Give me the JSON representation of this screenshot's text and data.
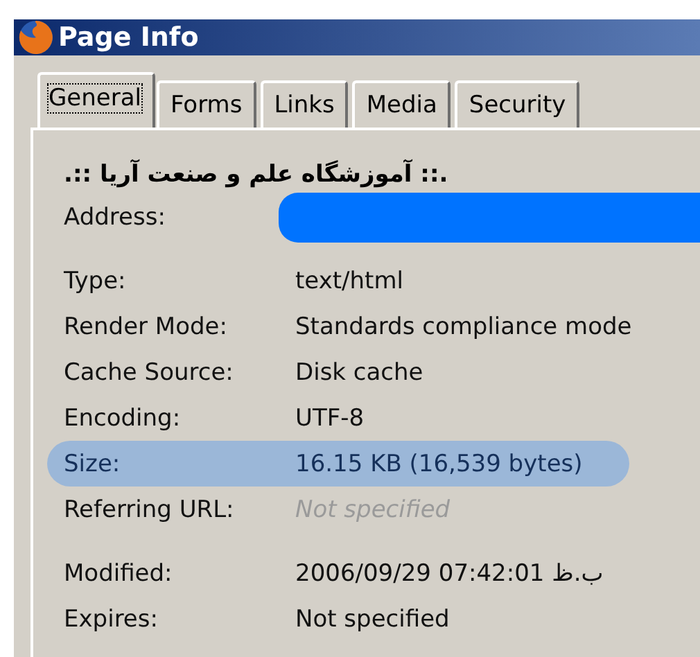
{
  "window": {
    "title": "Page Info"
  },
  "tabs": [
    {
      "label": "General",
      "selected": true
    },
    {
      "label": "Forms",
      "selected": false
    },
    {
      "label": "Links",
      "selected": false
    },
    {
      "label": "Media",
      "selected": false
    },
    {
      "label": "Security",
      "selected": false
    }
  ],
  "page_title": ".:: آموزشگاه علم و صنعت آریا ::.",
  "groups": [
    [
      {
        "label": "Address:",
        "redacted": true
      }
    ],
    [
      {
        "label": "Type:",
        "value": "text/html",
        "highlighted": false,
        "muted": false
      },
      {
        "label": "Render Mode:",
        "value": "Standards compliance mode",
        "highlighted": false,
        "muted": false
      },
      {
        "label": "Cache Source:",
        "value": "Disk cache",
        "highlighted": false,
        "muted": false
      },
      {
        "label": "Encoding:",
        "value": "UTF-8",
        "highlighted": false,
        "muted": false
      },
      {
        "label": "Size:",
        "value": "16.15 KB (16,539 bytes)",
        "highlighted": true,
        "muted": false
      },
      {
        "label": "Referring URL:",
        "value": "Not specified",
        "highlighted": false,
        "muted": true
      }
    ],
    [
      {
        "label": "Modified:",
        "value": "2006/09/29 07:42:01 ب.ظ",
        "highlighted": false,
        "muted": false
      },
      {
        "label": "Expires:",
        "value": "Not specified",
        "highlighted": false,
        "muted": false
      }
    ]
  ]
}
